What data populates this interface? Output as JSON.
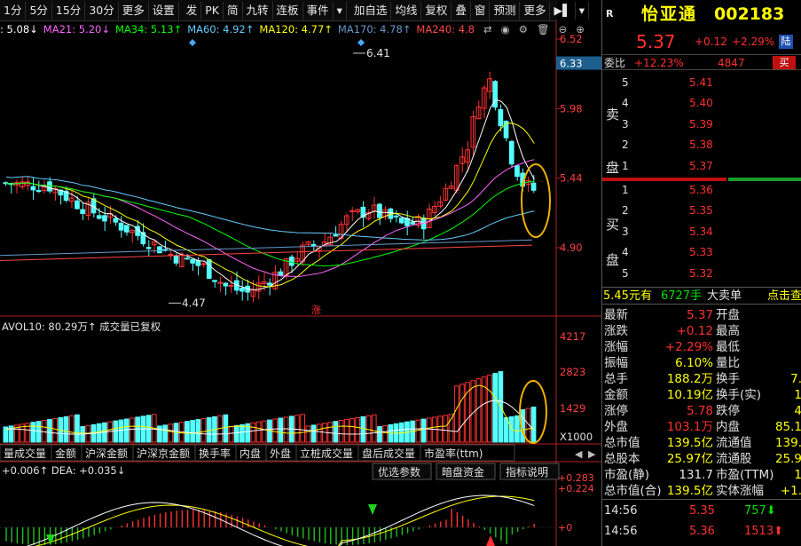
{
  "toolbar": {
    "items": [
      "1分",
      "5分",
      "15分",
      "30分",
      "更多",
      "设置",
      "发",
      "PK",
      "简",
      "九转",
      "连板",
      "事件",
      "▾",
      "加自选",
      "均线",
      "复权",
      "叠",
      "窗",
      "预测",
      "更多",
      "▶▌",
      "▾"
    ]
  },
  "ma_legend": [
    {
      "text": ": 5.08↓",
      "color": "#ffffff"
    },
    {
      "text": "MA21: 5.20↓",
      "color": "#ff66ff"
    },
    {
      "text": "MA34: 5.13↑",
      "color": "#00ff00"
    },
    {
      "text": "MA60: 4.92↑",
      "color": "#66ccff"
    },
    {
      "text": "MA120: 4.77↑",
      "color": "#ffff00"
    },
    {
      "text": "MA170: 4.78↑",
      "color": "#6699cc"
    },
    {
      "text": "MA240: 4.8",
      "color": "#ff4444"
    }
  ],
  "price_axis": [
    "6.52",
    "5.98",
    "5.44",
    "4.90"
  ],
  "price_current": "6.33",
  "price_annotations": {
    "high": "6.41",
    "low": "4.47"
  },
  "volume_title": "AVOL10: 80.29万↑  成交量已复权",
  "volume_axis": [
    "4217",
    "2823",
    "1429",
    "X1000"
  ],
  "volume_tabs": [
    "量成交量",
    "金额",
    "沪深金额",
    "沪深京金额",
    "换手率",
    "内盘",
    "外盘",
    "立桩成交量",
    "盘后成交量",
    "市盈率(ttm)"
  ],
  "macd_title": "+0.006↑  DEA: +0.035↓",
  "macd_tabs": [
    "优选参数",
    "暗盘资金",
    "指标说明"
  ],
  "macd_axis": [
    "+0.283",
    "+0.224",
    "+0"
  ],
  "stock": {
    "name": "怡亚通",
    "code": "002183",
    "price": "5.37",
    "change": "+0.12",
    "change_pct": "+2.29%",
    "market_tag": "陆",
    "weibi_label": "委比",
    "weibi": "+12.23%",
    "weicha": "4847",
    "buy_btn": "买",
    "sell_side_label": "卖盘",
    "buy_side_label": "买盘"
  },
  "asks": [
    {
      "level": "5",
      "price": "5.41"
    },
    {
      "level": "4",
      "price": "5.40"
    },
    {
      "level": "3",
      "price": "5.39"
    },
    {
      "level": "2",
      "price": "5.38"
    },
    {
      "level": "1",
      "price": "5.37"
    }
  ],
  "bids": [
    {
      "level": "1",
      "price": "5.36"
    },
    {
      "level": "2",
      "price": "5.35"
    },
    {
      "level": "3",
      "price": "5.34"
    },
    {
      "level": "4",
      "price": "5.33"
    },
    {
      "level": "5",
      "price": "5.32"
    }
  ],
  "big_order": {
    "price": "5.45元有",
    "qty": "6727手",
    "label": "大卖单",
    "link": "点击查"
  },
  "stats": [
    {
      "l1": "最新",
      "v1": "5.37",
      "c1": "red",
      "l2": "开盘"
    },
    {
      "l1": "涨跌",
      "v1": "+0.12",
      "c1": "red",
      "l2": "最高"
    },
    {
      "l1": "涨幅",
      "v1": "+2.29%",
      "c1": "red",
      "l2": "最低"
    },
    {
      "l1": "振幅",
      "v1": "6.10%",
      "c1": "yellow",
      "l2": "量比"
    },
    {
      "l1": "总手",
      "v1": "188.2万",
      "c1": "yellow",
      "l2": "换手",
      "v2": "7."
    },
    {
      "l1": "金额",
      "v1": "10.19亿",
      "c1": "yellow",
      "l2": "换手(实)",
      "v2": "1"
    },
    {
      "l1": "涨停",
      "v1": "5.78",
      "c1": "red",
      "l2": "跌停",
      "v2": "4"
    },
    {
      "l1": "外盘",
      "v1": "103.1万",
      "c1": "red",
      "l2": "内盘",
      "v2": "85.1"
    },
    {
      "l1": "总市值",
      "v1": "139.5亿",
      "c1": "yellow",
      "l2": "流通值",
      "v2": "139."
    },
    {
      "l1": "总股本",
      "v1": "25.97亿",
      "c1": "yellow",
      "l2": "流通股",
      "v2": "25.9"
    },
    {
      "l1": "市盈(静)",
      "v1": "131.7",
      "c1": "white",
      "l2": "市盈(TTM)",
      "v2": "1"
    },
    {
      "l1": "总市值(合)",
      "v1": "139.5亿",
      "c1": "yellow",
      "l2": "实体涨幅",
      "v2": "+1."
    }
  ],
  "ticks": [
    {
      "time": "14:56",
      "price": "5.35",
      "vol": "757",
      "dir": "down"
    },
    {
      "time": "14:56",
      "price": "5.36",
      "vol": "1513",
      "dir": "up"
    }
  ],
  "r_label": "R",
  "zhang_label": "涨",
  "chart_colors": {
    "up": "#ff3232",
    "down": "#54ffff",
    "ring": "#f0b000"
  }
}
